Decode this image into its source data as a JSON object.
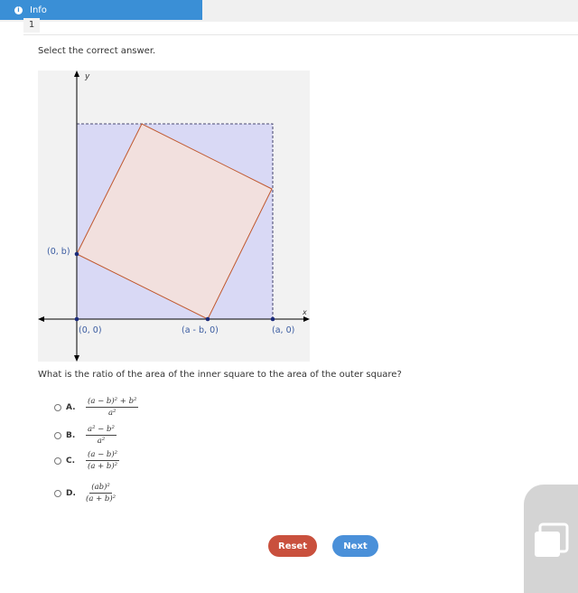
{
  "header": {
    "info_label": "Info",
    "question_number": "1"
  },
  "instruction": "Select the correct answer.",
  "figure": {
    "axis_x_label": "x",
    "axis_y_label": "y",
    "point_labels": {
      "zero_b": "(0, b)",
      "origin": "(0, 0)",
      "a_minus_b": "(a - b, 0)",
      "a_zero": "(a, 0)"
    },
    "colors": {
      "outer_fill": "#d9d9f5",
      "inner_fill": "#f2e0de",
      "inner_stroke": "#c0582e",
      "point": "#1a2a7a"
    }
  },
  "question": "What is the ratio of the area of the inner square to the area of the outer square?",
  "options": [
    {
      "letter": "A.",
      "numerator": "(a − b)² + b²",
      "denominator": "a²"
    },
    {
      "letter": "B.",
      "numerator": "a² − b²",
      "denominator": "a²"
    },
    {
      "letter": "C.",
      "numerator": "(a − b)²",
      "denominator": "(a + b)²"
    },
    {
      "letter": "D.",
      "numerator": "(ab)²",
      "denominator": "(a + b)²"
    }
  ],
  "buttons": {
    "reset": "Reset",
    "next": "Next"
  },
  "icons": {
    "info": "info-icon",
    "corner": "copy-icon"
  }
}
